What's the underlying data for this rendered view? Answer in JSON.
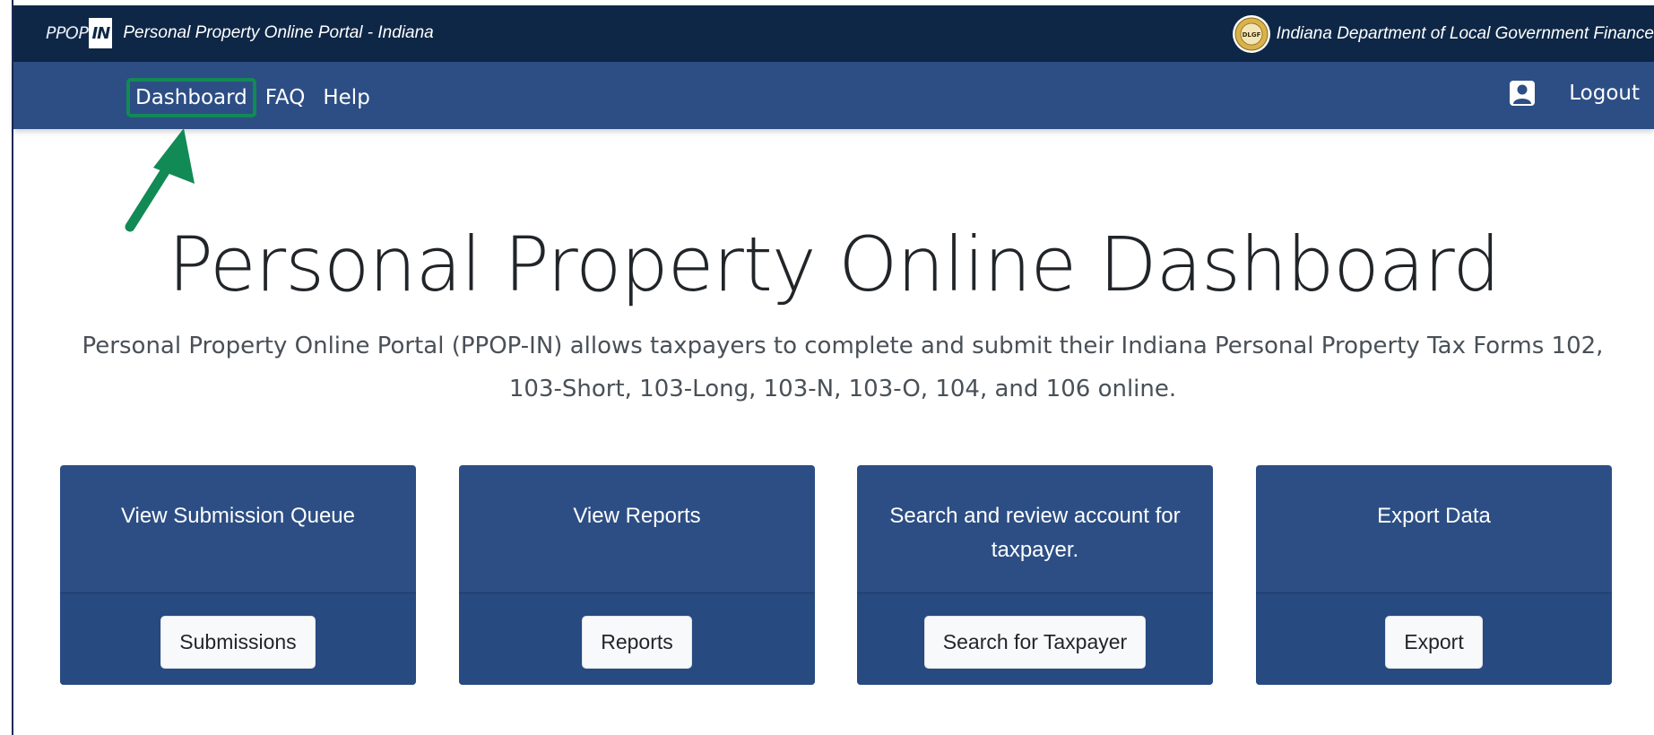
{
  "header": {
    "logo_text": "PPOP",
    "logo_box_text": "IN",
    "site_title": "Personal Property Online Portal - Indiana",
    "seal_text": "DLGF",
    "agency_name": "Indiana Department of Local Government Finance"
  },
  "nav": {
    "items": [
      {
        "label": "Dashboard"
      },
      {
        "label": "FAQ"
      },
      {
        "label": "Help"
      }
    ],
    "logout_label": "Logout"
  },
  "hero": {
    "title": "Personal Property Online Dashboard",
    "description": "Personal Property Online Portal (PPOP-IN) allows taxpayers to complete and submit their Indiana Personal Property Tax Forms 102, 103-Short, 103-Long, 103-N, 103-O, 104, and 106 online."
  },
  "cards": [
    {
      "title": "View Submission Queue",
      "button": "Submissions"
    },
    {
      "title": "View Reports",
      "button": "Reports"
    },
    {
      "title": "Search and review account for taxpayer.",
      "button": "Search for Taxpayer"
    },
    {
      "title": "Export Data",
      "button": "Export"
    }
  ],
  "colors": {
    "topbar": "#0e2746",
    "navbar": "#2c4e84",
    "card": "#2c4e84",
    "highlight": "#128a55",
    "annotation_arrow": "#128a55"
  },
  "icons": {
    "user": "user-icon",
    "annotation": "arrow-icon"
  }
}
